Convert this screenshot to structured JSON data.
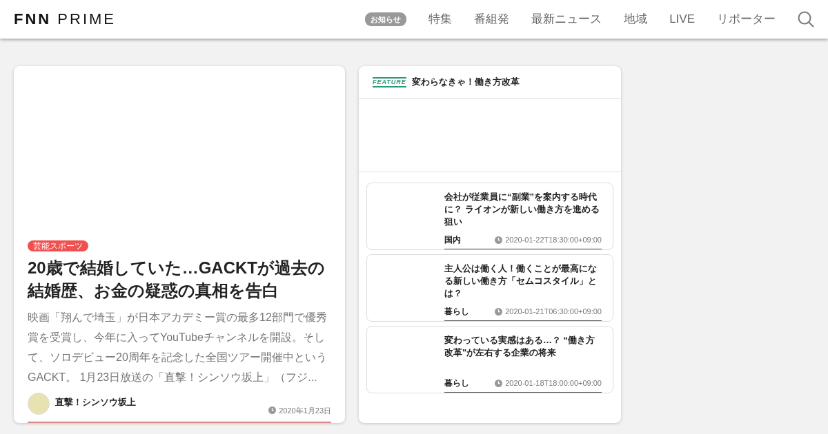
{
  "header": {
    "logo": {
      "main": "FNN",
      "sub": "PRIME"
    },
    "notice": "お知らせ",
    "nav": [
      "特集",
      "番組発",
      "最新ニュース",
      "地域",
      "LIVE",
      "リポーター"
    ]
  },
  "main_article": {
    "category": "芸能スポーツ",
    "title": "20歳で結婚していた…GACKTが過去の結婚歴、お金の疑惑の真相を告白",
    "summary": "映画「翔んで埼玉」が日本アカデミー賞の最多12部門で優秀賞を受賞し、今年に入ってYouTubeチャンネルを開設。そして、ソロデビュー20周年を記念した全国ツアー開催中というGACKT。 1月23日放送の「直撃！シンソウ坂上」（フジ...",
    "program": "直撃！シンソウ坂上",
    "date": "2020年1月23日"
  },
  "feature": {
    "label": "FEATURE",
    "title": "変わらなきゃ！働き方改革",
    "articles": [
      {
        "title": "会社が従業員に“副業”を案内する時代に？ ライオンが新しい働き方を進める狙い",
        "category": "国内",
        "date": "2020-01-22T18:30:00+09:00"
      },
      {
        "title": "主人公は働く人！働くことが最高になる新しい働き方「セムコスタイル」とは？",
        "category": "暮らし",
        "date": "2020-01-21T06:30:00+09:00"
      },
      {
        "title": "変わっている実感はある…？ “働き方改革\"が左右する企業の将来",
        "category": "暮らし",
        "date": "2020-01-18T18:00:00+09:00"
      }
    ]
  }
}
